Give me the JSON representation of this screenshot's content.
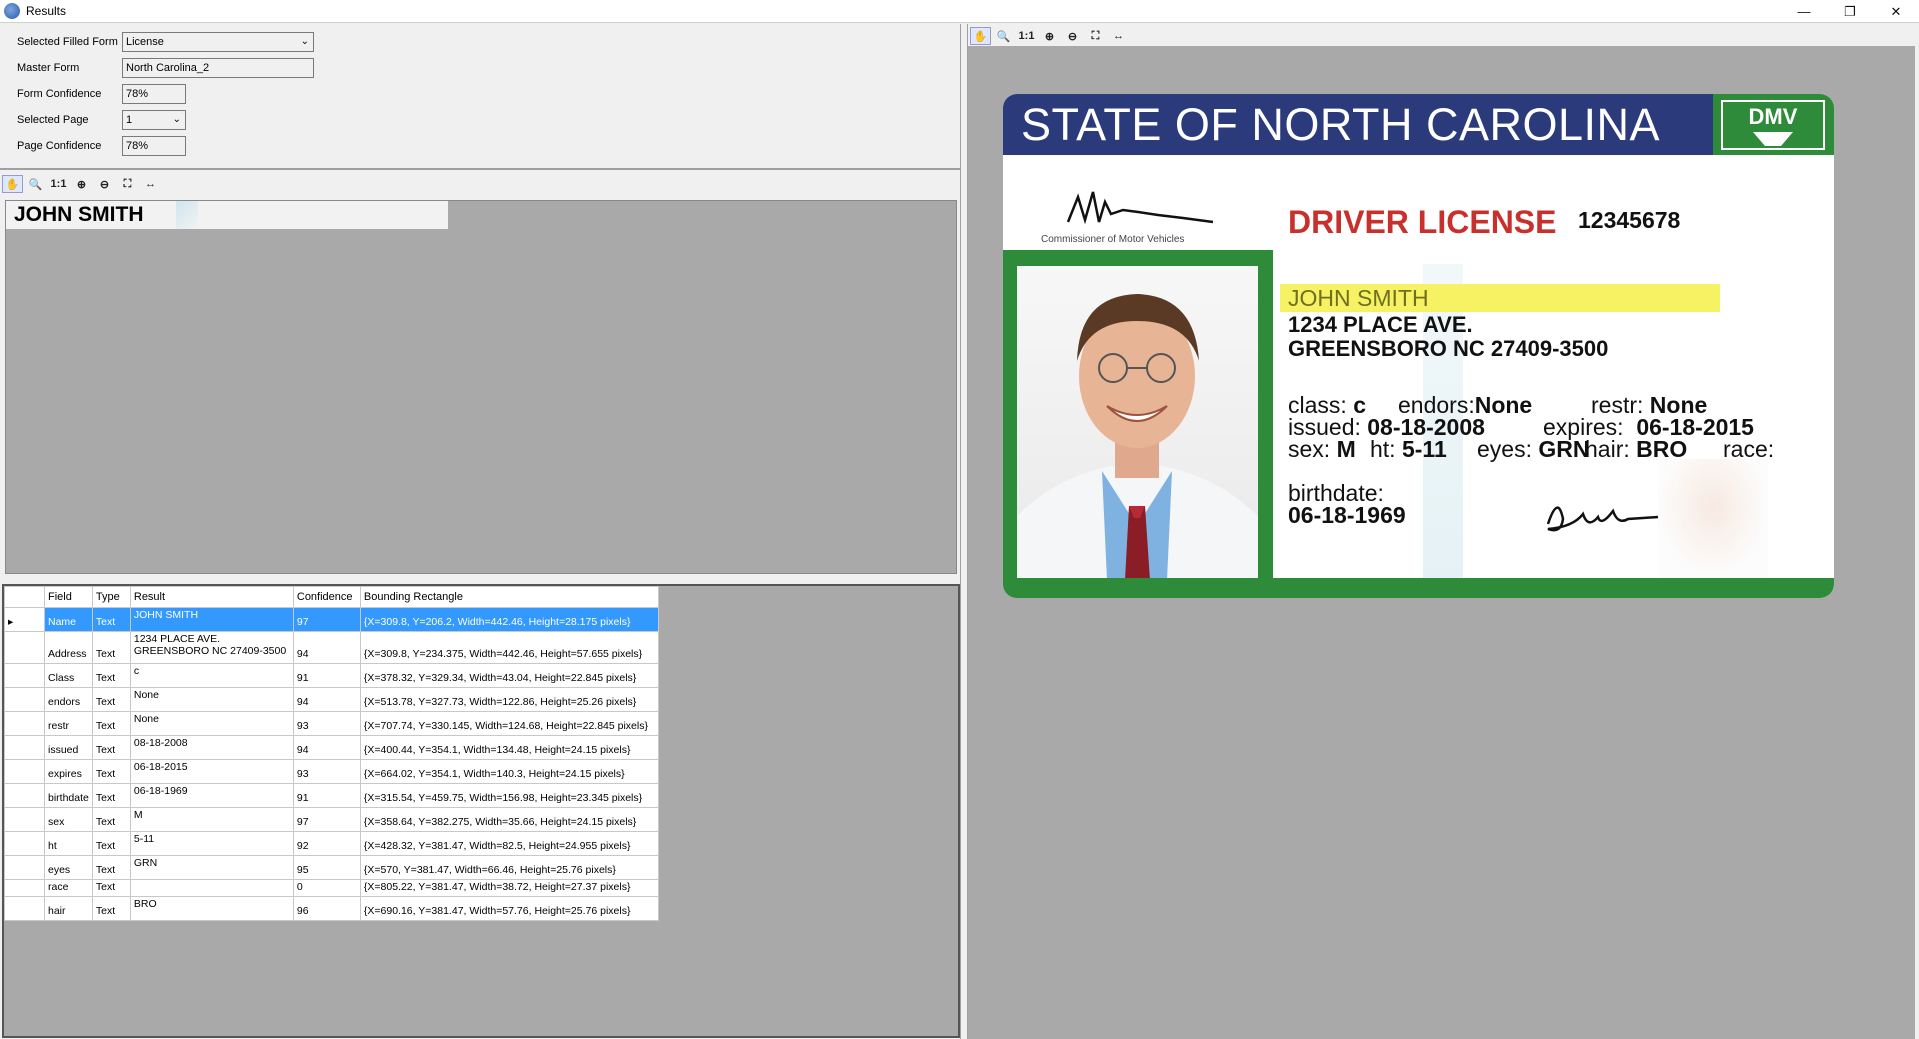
{
  "window": {
    "title": "Results"
  },
  "form": {
    "selected_filled_form_label": "Selected Filled Form",
    "selected_filled_form_value": "License",
    "master_form_label": "Master Form",
    "master_form_value": "North Carolina_2",
    "form_confidence_label": "Form Confidence",
    "form_confidence_value": "78%",
    "selected_page_label": "Selected Page",
    "selected_page_value": "1",
    "page_confidence_label": "Page Confidence",
    "page_confidence_value": "78%"
  },
  "toolbar": {
    "actual_size_label": "1:1"
  },
  "preview": {
    "text": "JOHN SMITH"
  },
  "grid": {
    "columns": [
      "Field",
      "Type",
      "Result",
      "Confidence",
      "Bounding Rectangle"
    ],
    "rows": [
      {
        "field": "Name",
        "type": "Text",
        "result": "JOHN SMITH",
        "confidence": "97",
        "rect": "{X=309.8, Y=206.2, Width=442.46, Height=28.175 pixels}",
        "selected": true
      },
      {
        "field": "Address",
        "type": "Text",
        "result": "1234 PLACE AVE.\nGREENSBORO NC 27409-3500",
        "confidence": "94",
        "rect": "{X=309.8, Y=234.375, Width=442.46, Height=57.655 pixels}"
      },
      {
        "field": "Class",
        "type": "Text",
        "result": "c",
        "confidence": "91",
        "rect": "{X=378.32, Y=329.34, Width=43.04, Height=22.845 pixels}"
      },
      {
        "field": "endors",
        "type": "Text",
        "result": "None",
        "confidence": "94",
        "rect": "{X=513.78, Y=327.73, Width=122.86, Height=25.26 pixels}"
      },
      {
        "field": "restr",
        "type": "Text",
        "result": "None",
        "confidence": "93",
        "rect": "{X=707.74, Y=330.145, Width=124.68, Height=22.845 pixels}"
      },
      {
        "field": "issued",
        "type": "Text",
        "result": "08-18-2008",
        "confidence": "94",
        "rect": "{X=400.44, Y=354.1, Width=134.48, Height=24.15 pixels}"
      },
      {
        "field": "expires",
        "type": "Text",
        "result": "06-18-2015",
        "confidence": "93",
        "rect": "{X=664.02, Y=354.1, Width=140.3, Height=24.15 pixels}"
      },
      {
        "field": "birthdate",
        "type": "Text",
        "result": "06-18-1969",
        "confidence": "91",
        "rect": "{X=315.54, Y=459.75, Width=156.98, Height=23.345 pixels}"
      },
      {
        "field": "sex",
        "type": "Text",
        "result": "M",
        "confidence": "97",
        "rect": "{X=358.64, Y=382.275, Width=35.66, Height=24.15 pixels}"
      },
      {
        "field": "ht",
        "type": "Text",
        "result": "5-11",
        "confidence": "92",
        "rect": "{X=428.32, Y=381.47, Width=82.5, Height=24.955 pixels}"
      },
      {
        "field": "eyes",
        "type": "Text",
        "result": "GRN",
        "confidence": "95",
        "rect": "{X=570, Y=381.47, Width=66.46, Height=25.76 pixels}"
      },
      {
        "field": "race",
        "type": "Text",
        "result": "",
        "confidence": "0",
        "rect": "{X=805.22, Y=381.47, Width=38.72, Height=27.37 pixels}"
      },
      {
        "field": "hair",
        "type": "Text",
        "result": "BRO",
        "confidence": "96",
        "rect": "{X=690.16, Y=381.47, Width=57.76, Height=25.76 pixels}"
      }
    ]
  },
  "license": {
    "state_header": "STATE  OF NORTH CAROLINA",
    "dmv": "DMV",
    "commissioner": "Commissioner of Motor Vehicles",
    "title": "DRIVER LICENSE",
    "number": "12345678",
    "name": "JOHN SMITH",
    "address1": "1234 PLACE AVE.",
    "address2": "GREENSBORO NC 27409-3500",
    "class_label": "class:",
    "class_value": "c",
    "endors_label": "endors:",
    "endors_value": "None",
    "restr_label": "restr:",
    "restr_value": "None",
    "issued_label": "issued:",
    "issued_value": "08-18-2008",
    "expires_label": "expires:",
    "expires_value": "06-18-2015",
    "sex_label": "sex:",
    "sex_value": "M",
    "ht_label": "ht:",
    "ht_value": "5-11",
    "eyes_label": "eyes:",
    "eyes_value": "GRN",
    "hair_label": "hair:",
    "hair_value": "BRO",
    "race_label": "race:",
    "birthdate_label": "birthdate:",
    "birthdate_value": "06-18-1969"
  },
  "icons": {
    "toolbar": [
      "pan-hand-icon",
      "zoom-window-icon",
      "actual-size-icon",
      "zoom-in-icon",
      "zoom-out-icon",
      "fit-page-icon",
      "fit-width-icon"
    ]
  },
  "colors": {
    "header_blue": "#2b3a7a",
    "frame_green": "#2e8b3a",
    "title_red": "#c8302c",
    "highlight_yellow": "#f7f264",
    "selection_blue": "#3399ff",
    "viewer_gray": "#a9a9a9"
  }
}
